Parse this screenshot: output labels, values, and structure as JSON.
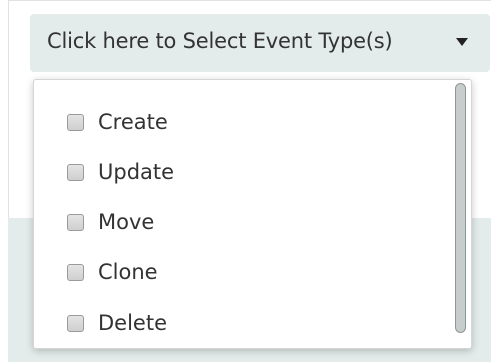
{
  "select": {
    "label": "Click here to Select Event Type(s)",
    "caret_icon": "caret-down-icon"
  },
  "dropdown": {
    "options": [
      {
        "label": "Create",
        "checked": false
      },
      {
        "label": "Update",
        "checked": false
      },
      {
        "label": "Move",
        "checked": false
      },
      {
        "label": "Clone",
        "checked": false
      },
      {
        "label": "Delete",
        "checked": false
      }
    ]
  },
  "colors": {
    "trigger_background": "#e3eceb",
    "text": "#333333",
    "scrollbar_thumb": "#c6cdcc"
  }
}
